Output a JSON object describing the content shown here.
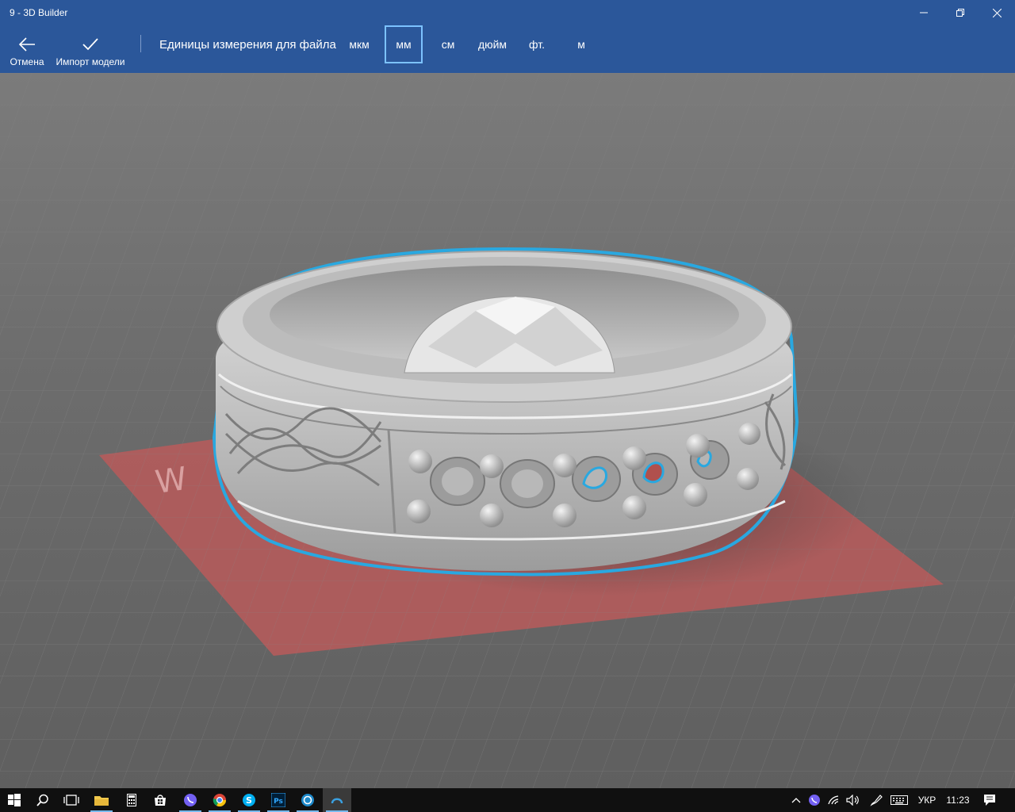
{
  "window": {
    "title": "9 - 3D Builder"
  },
  "commands": {
    "cancel_label": "Отмена",
    "import_label": "Импорт модели",
    "units_label": "Единицы измерения для файла",
    "units": [
      "мкм",
      "мм",
      "см",
      "дюйм",
      "фт.",
      "м"
    ],
    "selected_unit": "мм"
  },
  "colors": {
    "accent": "#2b579a",
    "selection_outline": "#29a8e0",
    "build_plate": "#c0504d"
  },
  "taskbar": {
    "items": [
      "start-icon",
      "search-icon",
      "task-view-icon",
      "file-explorer-icon",
      "calculator-icon",
      "store-icon",
      "viber-icon",
      "chrome-icon",
      "skype-icon",
      "photoshop-icon",
      "app-icon",
      "3d-builder-icon"
    ],
    "language": "УКР",
    "time": "11:23"
  }
}
